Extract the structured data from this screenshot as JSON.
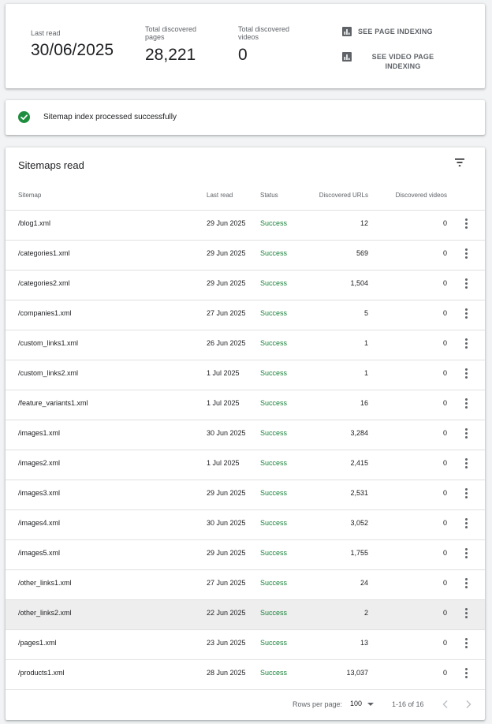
{
  "summary": {
    "last_read_label": "Last read",
    "last_read_value": "30/06/2025",
    "pages_label": "Total discovered pages",
    "pages_value": "28,221",
    "videos_label": "Total discovered videos",
    "videos_value": "0",
    "action_page": "SEE PAGE INDEXING",
    "action_video": "SEE VIDEO PAGE INDEXING"
  },
  "status": {
    "message": "Sitemap index processed successfully",
    "color": "#1e8e3e"
  },
  "table": {
    "title": "Sitemaps read",
    "columns": {
      "sitemap": "Sitemap",
      "last_read": "Last read",
      "status": "Status",
      "urls": "Discovered URLs",
      "videos": "Discovered videos"
    },
    "rows": [
      {
        "sitemap": "/blog1.xml",
        "last_read": "29 Jun 2025",
        "status": "Success",
        "urls": "12",
        "videos": "0"
      },
      {
        "sitemap": "/categories1.xml",
        "last_read": "29 Jun 2025",
        "status": "Success",
        "urls": "569",
        "videos": "0"
      },
      {
        "sitemap": "/categories2.xml",
        "last_read": "29 Jun 2025",
        "status": "Success",
        "urls": "1,504",
        "videos": "0"
      },
      {
        "sitemap": "/companies1.xml",
        "last_read": "27 Jun 2025",
        "status": "Success",
        "urls": "5",
        "videos": "0"
      },
      {
        "sitemap": "/custom_links1.xml",
        "last_read": "26 Jun 2025",
        "status": "Success",
        "urls": "1",
        "videos": "0"
      },
      {
        "sitemap": "/custom_links2.xml",
        "last_read": "1 Jul 2025",
        "status": "Success",
        "urls": "1",
        "videos": "0"
      },
      {
        "sitemap": "/feature_variants1.xml",
        "last_read": "1 Jul 2025",
        "status": "Success",
        "urls": "16",
        "videos": "0"
      },
      {
        "sitemap": "/images1.xml",
        "last_read": "30 Jun 2025",
        "status": "Success",
        "urls": "3,284",
        "videos": "0"
      },
      {
        "sitemap": "/images2.xml",
        "last_read": "1 Jul 2025",
        "status": "Success",
        "urls": "2,415",
        "videos": "0"
      },
      {
        "sitemap": "/images3.xml",
        "last_read": "29 Jun 2025",
        "status": "Success",
        "urls": "2,531",
        "videos": "0"
      },
      {
        "sitemap": "/images4.xml",
        "last_read": "30 Jun 2025",
        "status": "Success",
        "urls": "3,052",
        "videos": "0"
      },
      {
        "sitemap": "/images5.xml",
        "last_read": "29 Jun 2025",
        "status": "Success",
        "urls": "1,755",
        "videos": "0"
      },
      {
        "sitemap": "/other_links1.xml",
        "last_read": "27 Jun 2025",
        "status": "Success",
        "urls": "24",
        "videos": "0"
      },
      {
        "sitemap": "/other_links2.xml",
        "last_read": "22 Jun 2025",
        "status": "Success",
        "urls": "2",
        "videos": "0",
        "highlighted": true
      },
      {
        "sitemap": "/pages1.xml",
        "last_read": "23 Jun 2025",
        "status": "Success",
        "urls": "13",
        "videos": "0"
      },
      {
        "sitemap": "/products1.xml",
        "last_read": "28 Jun 2025",
        "status": "Success",
        "urls": "13,037",
        "videos": "0"
      }
    ]
  },
  "footer": {
    "rows_per_page_label": "Rows per page:",
    "rows_per_page_value": "100",
    "range": "1-16 of 16"
  },
  "icons": {
    "chart": "bar-chart-icon",
    "check": "check-circle-icon",
    "filter": "filter-icon",
    "more": "more-vert-icon",
    "prev": "chevron-left-icon",
    "next": "chevron-right-icon"
  }
}
